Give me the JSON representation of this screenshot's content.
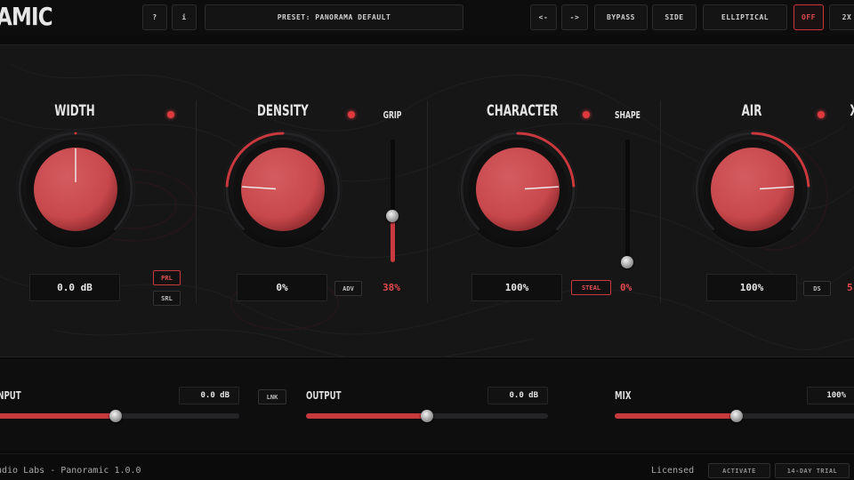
{
  "header": {
    "logo": "AMIC",
    "help_label": "?",
    "info_label": "i",
    "preset_label": "PRESET: PANORAMA DEFAULT",
    "prev_label": "<-",
    "next_label": "->",
    "bypass_label": "BYPASS",
    "side_label": "SIDE",
    "mode_label": "ELLIPTICAL",
    "off_label": "OFF",
    "oversample_label": "2X"
  },
  "modules": {
    "width": {
      "label": "WIDTH",
      "value": "0.0 dB",
      "tag1": "PRL",
      "tag2": "SRL",
      "knob_fraction": 0.5
    },
    "density": {
      "label": "DENSITY",
      "value": "0%",
      "tag": "ADV",
      "knob_fraction": 0.18
    },
    "grip": {
      "label": "GRIP",
      "value": "38%",
      "fraction": 0.38
    },
    "character": {
      "label": "CHARACTER",
      "value": "100%",
      "tag": "STEAL",
      "knob_fraction": 0.82
    },
    "shape": {
      "label": "SHAPE",
      "value": "0%",
      "fraction": 0.0
    },
    "air": {
      "label": "AIR",
      "value": "100%",
      "tag": "DS",
      "knob_fraction": 0.82,
      "extra_label": "X",
      "extra_value": "5"
    }
  },
  "bottom": {
    "input": {
      "label": "INPUT",
      "value": "0.0 dB",
      "fraction": 0.5
    },
    "link_label": "LNK",
    "output": {
      "label": "OUTPUT",
      "value": "0.0 dB",
      "fraction": 0.5
    },
    "mix": {
      "label": "MIX",
      "value": "100%",
      "fraction": 0.5
    }
  },
  "footer": {
    "version_text": "udio Labs - Panoramic 1.0.0",
    "license_text": "Licensed",
    "activate_label": "ACTIVATE",
    "trial_label": "14-DAY TRIAL"
  },
  "colors": {
    "accent": "#e03a3e",
    "knob_red": "#c8484c",
    "background": "#161617"
  }
}
